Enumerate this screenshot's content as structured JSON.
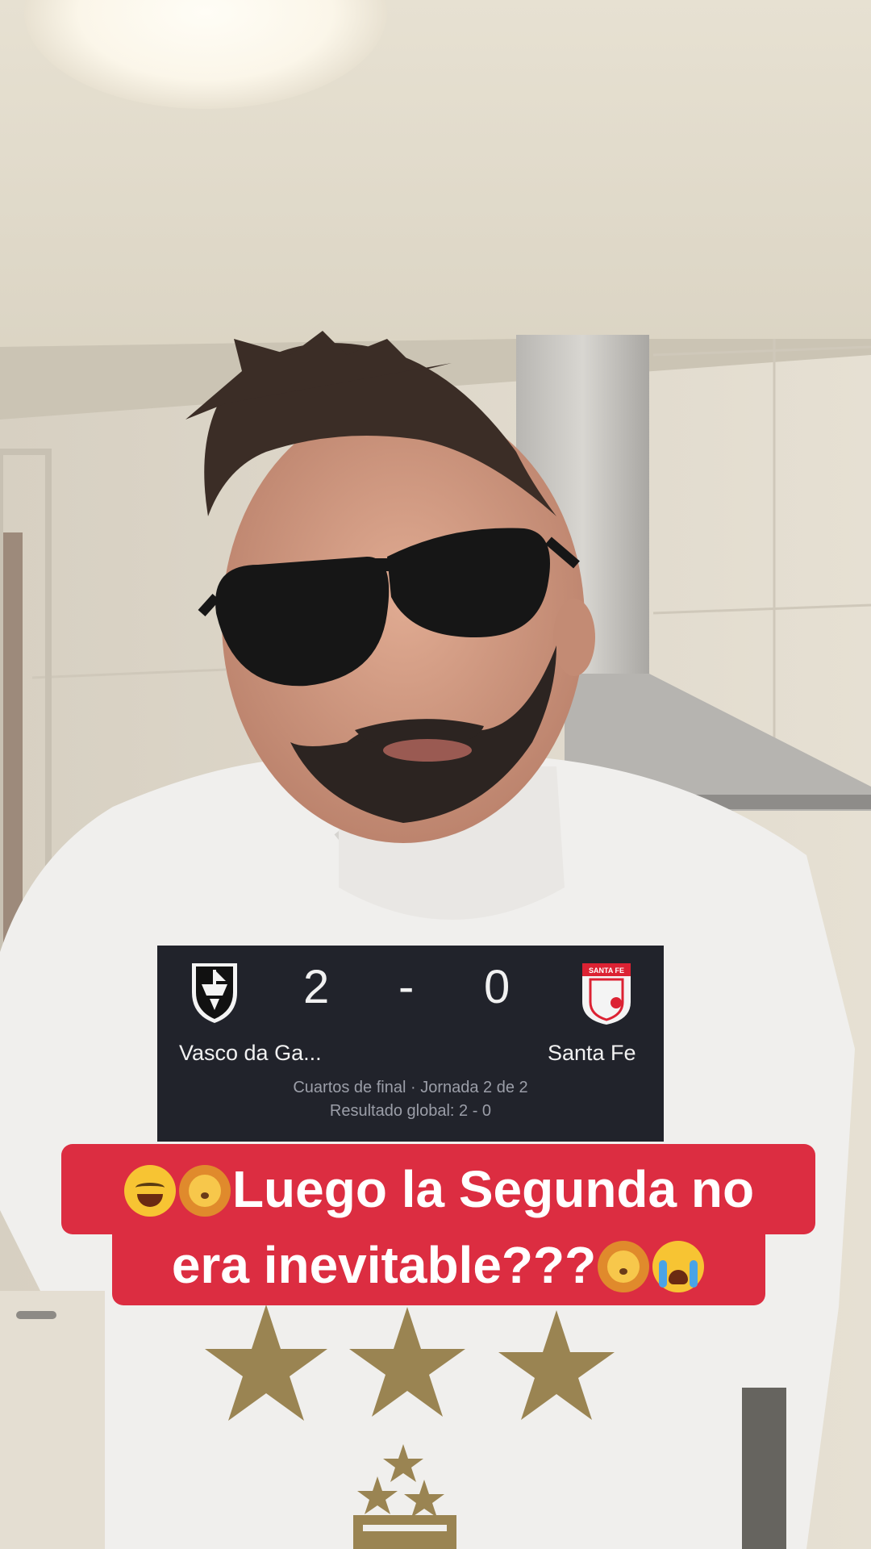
{
  "scoreboard": {
    "home_team": "Vasco da Ga...",
    "away_team": "Santa Fe",
    "home_score": "2",
    "separator": "-",
    "away_score": "0",
    "stage": "Cuartos de final · Jornada 2 de 2",
    "aggregate": "Resultado global: 2 - 0",
    "away_logo_text": "SANTA FE"
  },
  "caption": {
    "line1": "Luego la Segunda no",
    "line2": "era inevitable???"
  },
  "colors": {
    "card_bg": "#21232b",
    "caption_bg": "#dc2d41",
    "shirt": "#f0efed",
    "stars": "#9a8452"
  }
}
